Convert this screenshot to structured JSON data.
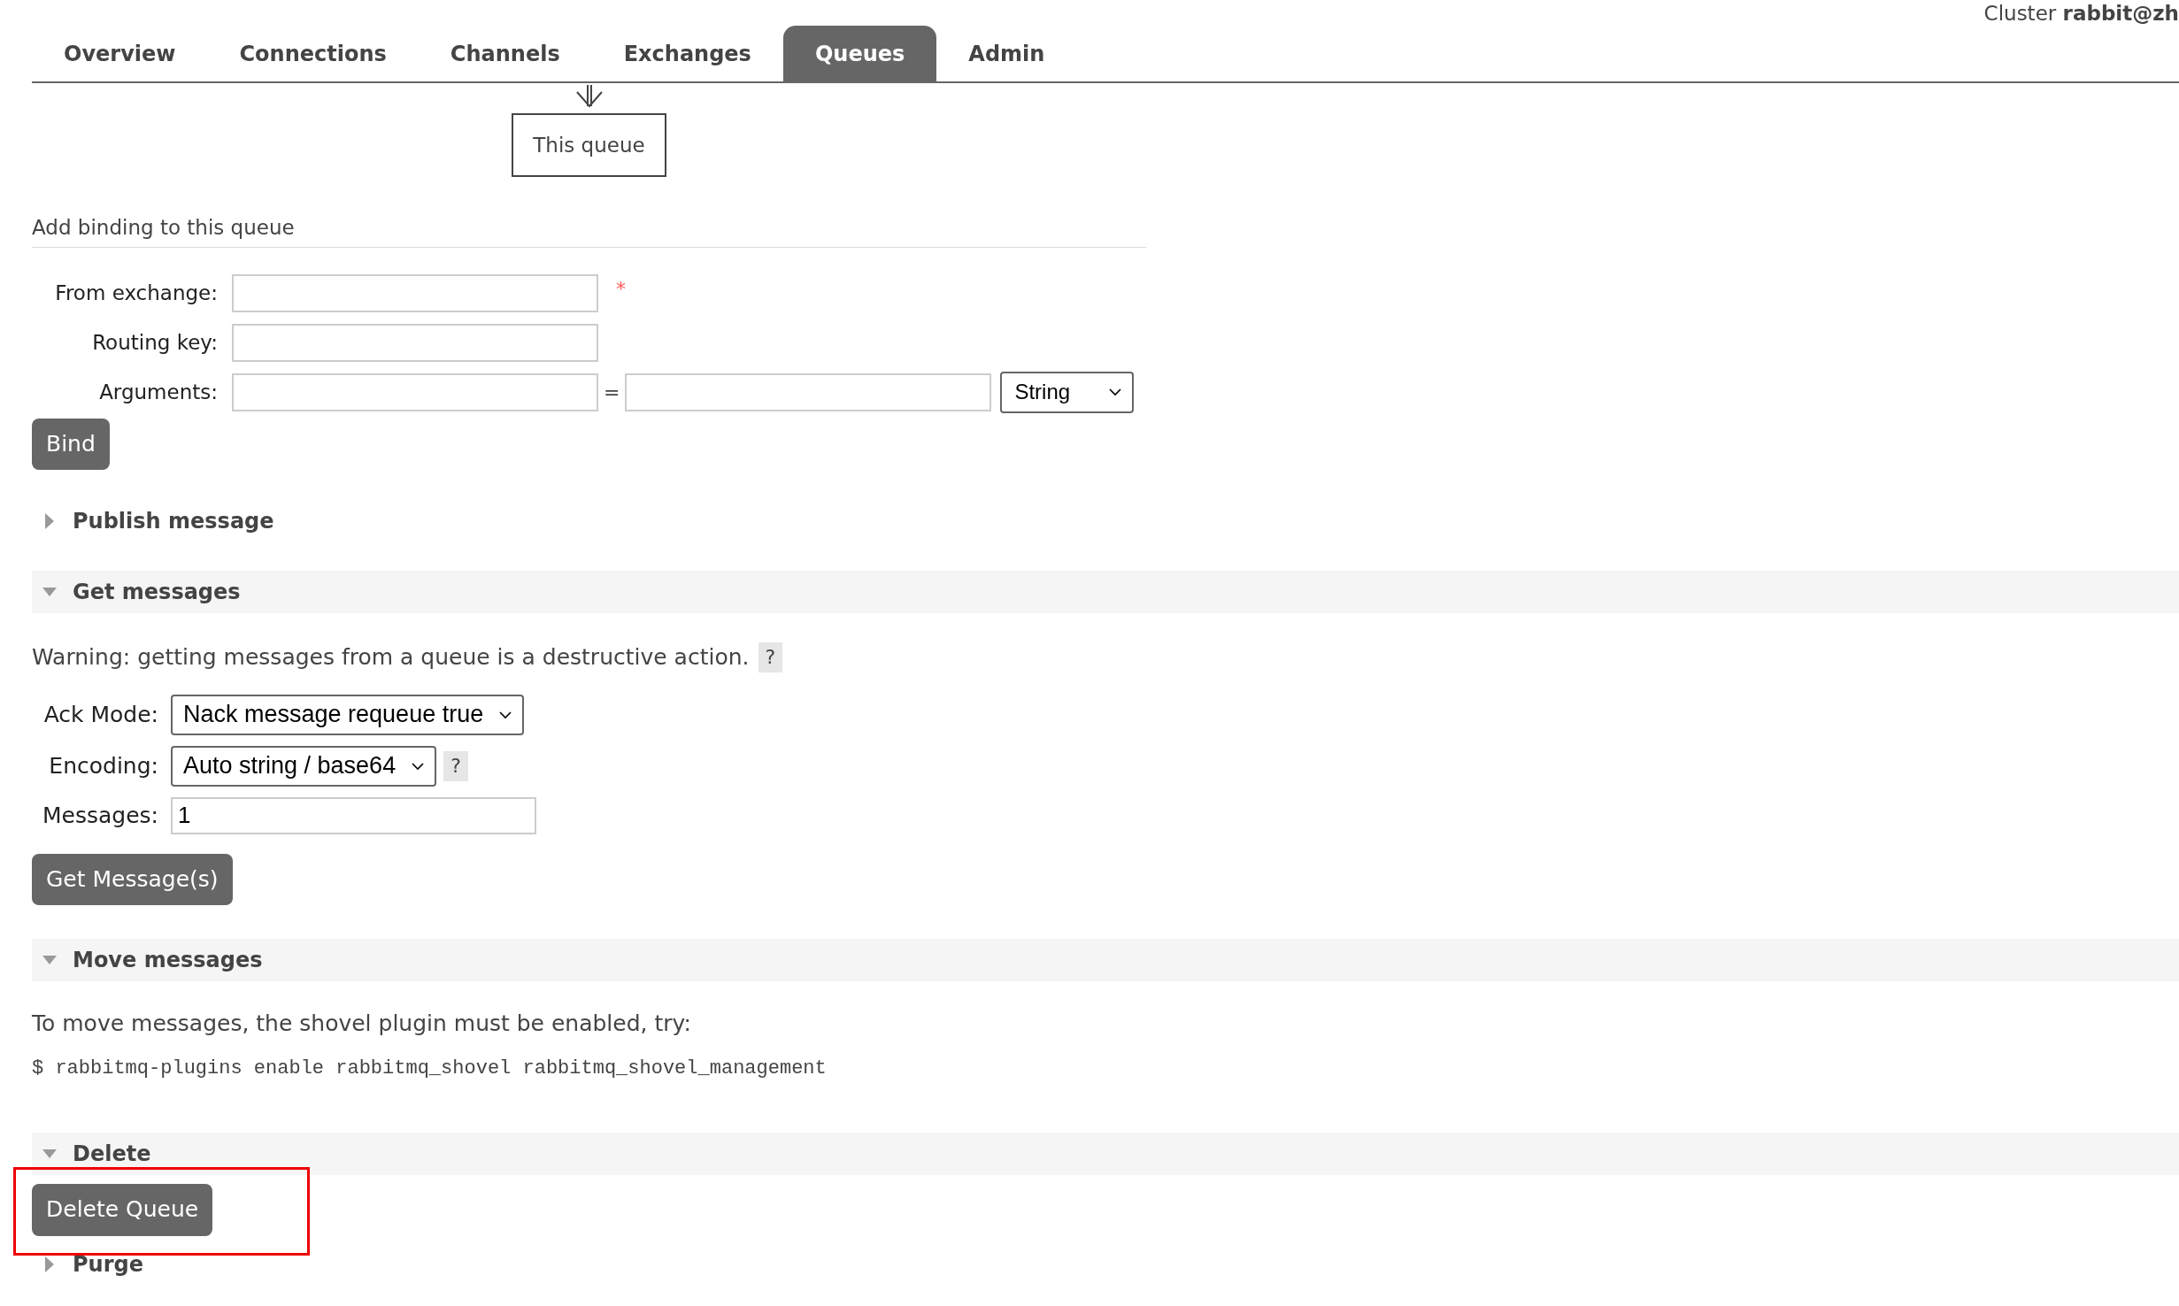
{
  "cluster": {
    "label": "Cluster",
    "name": "rabbit@zh"
  },
  "tabs": [
    {
      "label": "Overview",
      "selected": false
    },
    {
      "label": "Connections",
      "selected": false
    },
    {
      "label": "Channels",
      "selected": false
    },
    {
      "label": "Exchanges",
      "selected": false
    },
    {
      "label": "Queues",
      "selected": true
    },
    {
      "label": "Admin",
      "selected": false
    }
  ],
  "binding_diagram": {
    "target": "This queue"
  },
  "add_binding": {
    "title": "Add binding to this queue",
    "required_mark": "*",
    "separator": "=",
    "fields": [
      {
        "label": "From exchange:",
        "kind": "text",
        "required": true
      },
      {
        "label": "Routing key:",
        "kind": "text",
        "required": false
      },
      {
        "label": "Arguments:",
        "kind": "pair",
        "required": false,
        "type": "String"
      }
    ],
    "button": "Bind"
  },
  "sections": [
    {
      "title": "Publish message",
      "kind": "publish",
      "expanded": false
    },
    {
      "title": "Get messages",
      "kind": "get",
      "expanded": true,
      "warning": "Warning: getting messages from a queue is a destructive action.",
      "help": "?",
      "fields": [
        {
          "label": "Ack Mode:",
          "kind": "select",
          "value": "Nack message requeue true"
        },
        {
          "label": "Encoding:",
          "kind": "select",
          "value": "Auto string / base64",
          "help": "?"
        },
        {
          "label": "Messages:",
          "kind": "text",
          "value": "1"
        }
      ],
      "button": "Get Message(s)"
    },
    {
      "title": "Move messages",
      "kind": "move",
      "expanded": true,
      "text": "To move messages, the shovel plugin must be enabled, try:",
      "command": "$ rabbitmq-plugins enable rabbitmq_shovel rabbitmq_shovel_management"
    },
    {
      "title": "Delete",
      "kind": "delete",
      "expanded": true,
      "button": "Delete Queue",
      "highlighted": true
    },
    {
      "title": "Purge",
      "kind": "purge",
      "expanded": false
    }
  ]
}
